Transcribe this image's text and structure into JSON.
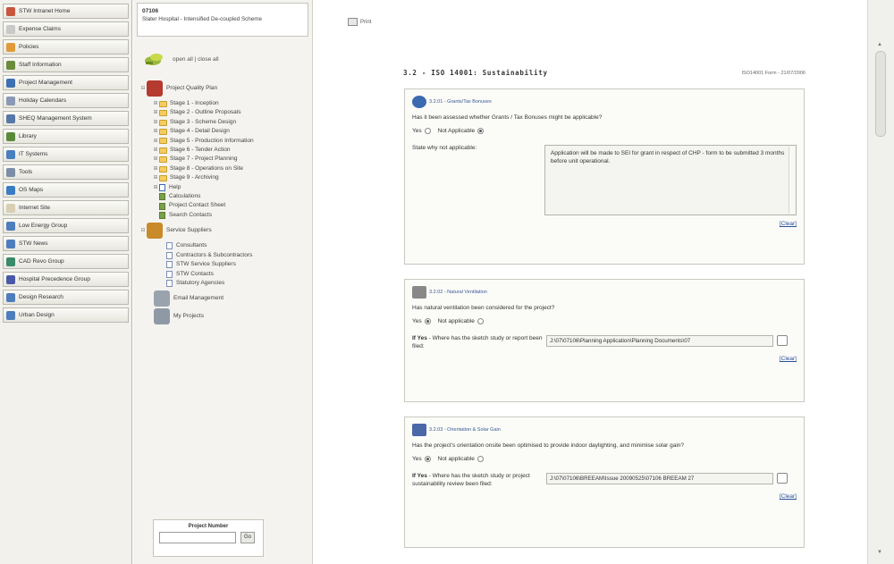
{
  "left_nav": {
    "items": [
      {
        "label": "STW Intranet Home",
        "icon": "house-icon",
        "color": "#c8553d"
      },
      {
        "label": "Expense Claims",
        "icon": "document-icon",
        "color": "#c9c9c9"
      },
      {
        "label": "Policies",
        "icon": "circle-icon",
        "color": "#e09a3a"
      },
      {
        "label": "Staff Information",
        "icon": "staff-icon",
        "color": "#6b8c3c"
      },
      {
        "label": "Project Management",
        "icon": "project-icon",
        "color": "#3f6fb3"
      },
      {
        "label": "Holiday Calendars",
        "icon": "calendar-icon",
        "color": "#8a9ab5"
      },
      {
        "label": "SHEQ Management System",
        "icon": "sheq-icon",
        "color": "#5778a8"
      },
      {
        "label": "Library",
        "icon": "library-icon",
        "color": "#5a8a3a"
      },
      {
        "label": "IT Systems",
        "icon": "it-icon",
        "color": "#4a7fc0"
      },
      {
        "label": "Tools",
        "icon": "tools-icon",
        "color": "#7c8da6"
      },
      {
        "label": "OS Maps",
        "icon": "globe-icon",
        "color": "#3b7cc4"
      },
      {
        "label": "Internet Site",
        "icon": "internet-icon",
        "color": "#d8cfb4"
      },
      {
        "label": "Low Energy Group",
        "icon": "group-icon",
        "color": "#4d7dbd"
      },
      {
        "label": "STW News",
        "icon": "news-icon",
        "color": "#4d7dbd"
      },
      {
        "label": "CAD Revo Group",
        "icon": "cad-icon",
        "color": "#3b8a6a"
      },
      {
        "label": "Hospital Precedence Group",
        "icon": "hospital-icon",
        "color": "#4a58a8"
      },
      {
        "label": "Design Research",
        "icon": "research-icon",
        "color": "#4d7dbd"
      },
      {
        "label": "Urban Design",
        "icon": "urban-icon",
        "color": "#4d7dbd"
      }
    ]
  },
  "project": {
    "code": "07106",
    "name": "Slater Hospital - Intensified De-coupled Scheme"
  },
  "tree_toolbar": {
    "open_close": "open all | close all"
  },
  "tree": [
    {
      "label": "Project Quality Plan",
      "level": 0,
      "kind": "root",
      "toggle": "⊟"
    },
    {
      "label": "Stage 1 - Inception",
      "level": 1,
      "kind": "folder",
      "toggle": "⊞"
    },
    {
      "label": "Stage 2 - Outline Proposals",
      "level": 1,
      "kind": "folder",
      "toggle": "⊞"
    },
    {
      "label": "Stage 3 - Scheme Design",
      "level": 1,
      "kind": "folder",
      "toggle": "⊞"
    },
    {
      "label": "Stage 4 - Detail Design",
      "level": 1,
      "kind": "folder",
      "toggle": "⊞"
    },
    {
      "label": "Stage 5 - Production Information",
      "level": 1,
      "kind": "folder",
      "toggle": "⊞"
    },
    {
      "label": "Stage 6 - Tender Action",
      "level": 1,
      "kind": "folder",
      "toggle": "⊞"
    },
    {
      "label": "Stage 7 - Project Planning",
      "level": 1,
      "kind": "folder",
      "toggle": "⊞"
    },
    {
      "label": "Stage 8 - Operations on Site",
      "level": 1,
      "kind": "folder",
      "toggle": "⊞"
    },
    {
      "label": "Stage 9 - Archiving",
      "level": 1,
      "kind": "folder",
      "toggle": "⊞"
    },
    {
      "label": "Help",
      "level": 1,
      "kind": "help",
      "toggle": "⊞"
    },
    {
      "label": "Calculations",
      "level": 1,
      "kind": "tool",
      "toggle": ""
    },
    {
      "label": "Project Contact Sheet",
      "level": 1,
      "kind": "tool",
      "toggle": ""
    },
    {
      "label": "Search Contacts",
      "level": 1,
      "kind": "tool",
      "toggle": ""
    },
    {
      "label": "Service Suppliers",
      "level": 0,
      "kind": "root",
      "toggle": "⊟"
    },
    {
      "label": "Consultants",
      "level": 1,
      "kind": "page",
      "toggle": ""
    },
    {
      "label": "Contractors & Subcontractors",
      "level": 1,
      "kind": "page",
      "toggle": ""
    },
    {
      "label": "STW Service Suppliers",
      "level": 1,
      "kind": "page",
      "toggle": ""
    },
    {
      "label": "STW Contacts",
      "level": 1,
      "kind": "page",
      "toggle": ""
    },
    {
      "label": "Statutory Agencies",
      "level": 1,
      "kind": "page",
      "toggle": ""
    },
    {
      "label": "Email Management",
      "level": 0,
      "kind": "root",
      "toggle": ""
    },
    {
      "label": "My Projects",
      "level": 0,
      "kind": "root",
      "toggle": ""
    }
  ],
  "project_number": {
    "label": "Project Number",
    "value": "",
    "go_label": "Go"
  },
  "main": {
    "print_label": "Print",
    "section_title": "3.2 - ISO 14001: Sustainability",
    "form_ref": "ISO14001 Form - 21/07/2006",
    "clear_label": "[Clear]",
    "cards": [
      {
        "tag": "3.2.01 - Grants/Tax Bonuses",
        "icon": "grant-icon",
        "question": "Has it been assessed whether Grants / Tax Bonuses might be applicable?",
        "option_a": "Yes",
        "option_b": "Not Applicable",
        "selected": "b",
        "field_label": "State why not applicable:",
        "field_label_prefix": "",
        "field_value": "Application will be made to SEI for grant in respect of CHP - form to be submitted 3 months before unit operational."
      },
      {
        "tag": "3.2.02 - Natural Ventilation",
        "icon": "ventilation-icon",
        "question": "Has natural ventilation been considered for the project?",
        "option_a": "Yes",
        "option_b": "Not applicable",
        "selected": "a",
        "field_label": "- Where has the sketch study or report been filed:",
        "field_label_prefix": "If Yes",
        "field_value": "J:\\07\\07106\\Planning Application\\Planning Documents\\07"
      },
      {
        "tag": "3.2.03 - Orientation & Solar Gain",
        "icon": "solar-panel-icon",
        "question": "Has the project's orientation onsite been optimised to provide indoor daylighting, and minimise solar gain?",
        "option_a": "Yes",
        "option_b": "Not applicable",
        "selected": "a",
        "field_label": "- Where has the sketch study or project sustainability review been filed:",
        "field_label_prefix": "If Yes",
        "field_value": "J:\\07\\07106\\BREEAM\\Issue 20090525\\07106 BREEAM 27"
      }
    ]
  },
  "colors": {
    "accent_link": "#2a4f9a",
    "panel_bg": "#f4f3ef",
    "nav_bg": "#f2f1ec"
  }
}
